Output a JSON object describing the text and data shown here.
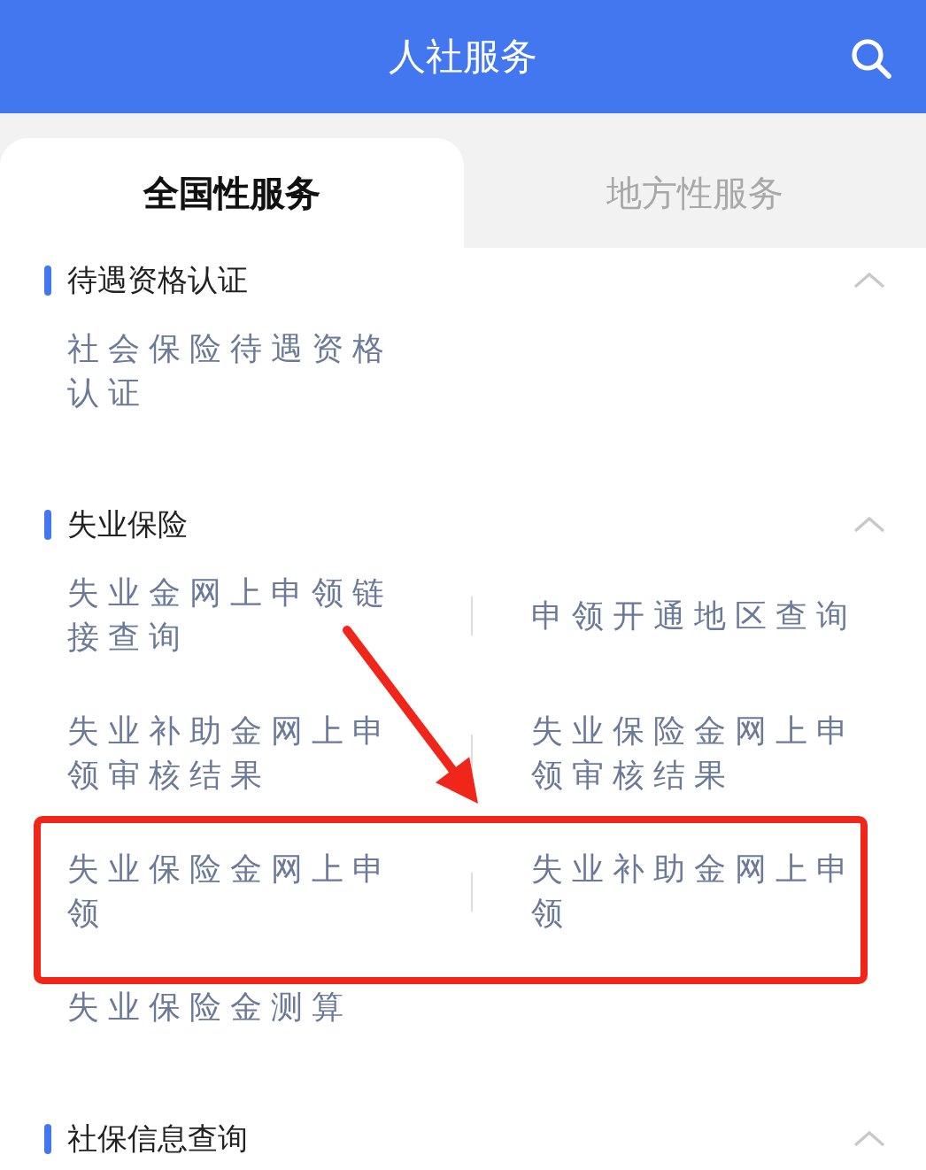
{
  "header": {
    "title": "人社服务"
  },
  "tabs": [
    {
      "label": "全国性服务",
      "selected": true
    },
    {
      "label": "地方性服务",
      "selected": false
    }
  ],
  "sections": [
    {
      "title": "待遇资格认证",
      "expanded": true,
      "items": [
        "社会保险待遇资格认证"
      ]
    },
    {
      "title": "失业保险",
      "expanded": true,
      "items": [
        "失业金网上申领链接查询",
        "申领开通地区查询",
        "失业补助金网上申领审核结果",
        "失业保险金网上申领审核结果",
        "失业保险金网上申领",
        "失业补助金网上申领",
        "失业保险金测算"
      ]
    },
    {
      "title": "社保信息查询",
      "expanded": true
    }
  ],
  "annotations": [
    {
      "kind": "arrow"
    },
    {
      "kind": "highlight_box"
    }
  ]
}
